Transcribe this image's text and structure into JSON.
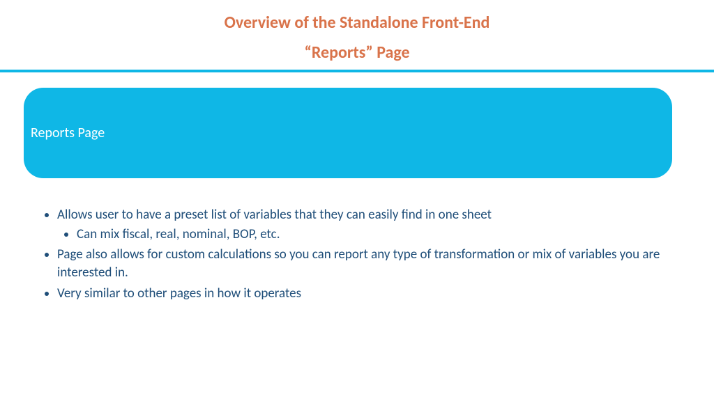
{
  "header": {
    "title": "Overview of the Standalone Front-End",
    "subtitle": "“Reports” Page"
  },
  "panel": {
    "label": "Reports Page"
  },
  "bullets": {
    "item1": "Allows user to have a preset list of variables that they can easily find in one sheet",
    "item1_sub1": "Can mix fiscal, real, nominal, BOP, etc.",
    "item2": "Page also allows for custom calculations so you can report any type of transformation or mix of variables you are interested in.",
    "item3": "Very similar to other pages in how it operates"
  }
}
